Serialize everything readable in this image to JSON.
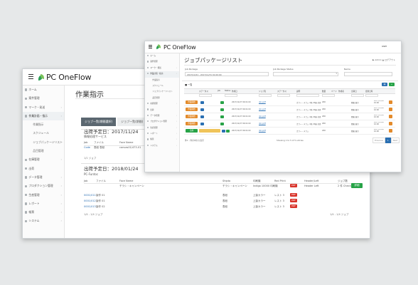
{
  "app": {
    "logo_text": "PC OneFlow"
  },
  "back_window": {
    "page_title": "作業指示",
    "sidebar": [
      {
        "label": "ホーム"
      },
      {
        "label": "案件管理"
      },
      {
        "label": "マーク・発送"
      },
      {
        "label": "作業計画・指示",
        "active": true
      },
      {
        "label": "作業指示",
        "sub": true
      },
      {
        "label": "スケジュール",
        "sub": true
      },
      {
        "label": "ジョブパッケージリスト",
        "sub": true
      },
      {
        "label": "品目管理",
        "sub": true
      },
      {
        "label": "在庫管理"
      },
      {
        "label": "出荷"
      },
      {
        "label": "データ管理"
      },
      {
        "label": "プロダクション管理"
      },
      {
        "label": "生産管理"
      },
      {
        "label": "レポート"
      },
      {
        "label": "帳票"
      },
      {
        "label": "システム"
      }
    ],
    "tabs": [
      "ジョブ一覧(期間選択)",
      "ジョブ一覧(期間)",
      "保存"
    ],
    "section1": {
      "heading": "出荷予定日：2017/11/24",
      "subheading": "情報処理サービス",
      "columns": [
        "Job",
        "ファイル",
        "Face Name"
      ],
      "rows": [
        {
          "job": "Code",
          "file": "表紙 表紙",
          "face": "canvas01/473-01"
        }
      ],
      "footer": "1/1 ジョブ"
    },
    "section2": {
      "heading": "出荷予定日：2018/01/24",
      "subheading": "PC-Funtoc",
      "columns": [
        "Job",
        "ファイル",
        "Face Name",
        "Shipto",
        "印刷機",
        "Red Print",
        "Header/Left",
        "ジョブ数"
      ],
      "header_row": {
        "face": "チラシ・キャンペーン",
        "shipto": "チラシ・キャンペーン",
        "press": "Indigo 10000 印刷機",
        "btn": "PDF",
        "header": "Header Left",
        "count": "2 件 Check",
        "action": "詳細"
      },
      "rows": [
        {
          "job": "0001/011",
          "file": "製作 01",
          "shipto": "表紙",
          "press": "上製カラー",
          "pages": "レスト 3",
          "btn": "PDF"
        },
        {
          "job": "0001/012",
          "file": "製作 01",
          "shipto": "表紙",
          "press": "上製カラー",
          "pages": "レスト 3",
          "btn": "PDF"
        },
        {
          "job": "0001/013",
          "file": "製作 02",
          "shipto": "表紙",
          "press": "上製カラー",
          "pages": "レスト 3",
          "btn": "PDF"
        }
      ],
      "footer_left": "1/4 - 1/4 ジョブ",
      "footer_right": "1/4 - 1/4 ジョブ"
    }
  },
  "front_window": {
    "page_title": "ジョブパッケージリスト",
    "user_label": "user",
    "header_right": "▶ Admin ▲ ログアウト",
    "sidebar": [
      {
        "label": "ホーム"
      },
      {
        "label": "案件管理"
      },
      {
        "label": "マーク・発送"
      },
      {
        "label": "作業計画・指示",
        "active": true
      },
      {
        "label": "作業指示",
        "sub": true
      },
      {
        "label": "スケジュール",
        "sub": true
      },
      {
        "label": "ジョブパッケージリスト",
        "sub": true
      },
      {
        "label": "品目管理",
        "sub": true
      },
      {
        "label": "在庫管理"
      },
      {
        "label": "出荷"
      },
      {
        "label": "データ管理"
      },
      {
        "label": "プロダクション管理"
      },
      {
        "label": "生産管理"
      },
      {
        "label": "レポート"
      },
      {
        "label": "帳票"
      },
      {
        "label": "システム"
      }
    ],
    "filters": {
      "label1": "Job Package",
      "value1": "2017/11/01 - 2017/11/31 01:00:00",
      "label2": "Job Package Status",
      "value2": "",
      "label3": "Name",
      "value3": ""
    },
    "list_label": "■ 一覧",
    "columns": [
      "",
      "ステータス",
      "Job",
      "Status",
      "作成日",
      "ジョブ名",
      "ステータス",
      "説明",
      "数量",
      "ページ",
      "作成者",
      "出荷日",
      "更新日時",
      ""
    ],
    "rows": [
      {
        "status": "作業開始",
        "sc": "#e38b2c",
        "created": "2017/11/27 09:01:00",
        "link": "doc.pdf",
        "desc": "カラー・チラシ 4色 20頁 全面印刷",
        "qty": "200",
        "user": "関東 東京",
        "date": "2017/11/28 10:00"
      },
      {
        "status": "作業開始",
        "sc": "#e38b2c",
        "created": "2017/11/27 09:01:00",
        "link": "doc.pdf",
        "desc": "カラー・チラシ 4色 20頁 全面印刷",
        "qty": "200",
        "user": "関東 東京",
        "date": "2017/11/28 10:00"
      },
      {
        "status": "作業開始",
        "sc": "#e38b2c",
        "created": "2017/11/27 09:01:00",
        "link": "doc.pdf",
        "desc": "カラー・チラシ 4色 20頁 全面印刷",
        "qty": "200",
        "user": "関東 東京",
        "date": "2017/11/28 10:00"
      },
      {
        "status": "作業開始",
        "sc": "#e38b2c",
        "created": "2017/11/27 09:01:00",
        "link": "doc.pdf",
        "desc": "カラー・チラシ 4色 20頁 全面印刷",
        "qty": "200",
        "user": "関東 東京",
        "date": "2017/11/28 10:00"
      },
      {
        "status": "出荷",
        "sc": "#27a347",
        "created": "2017/11/27 09:01:00",
        "link": "doc.pdf",
        "desc": "カラー・チラシ",
        "qty": "200",
        "user": "関東 東京",
        "date": "2017/11/28 10:00"
      }
    ],
    "footer_left": "件1 - 件の中から表示",
    "footer_center": "Showing 1 to 5 of 5 entries",
    "pager": [
      "Previous",
      "1",
      "Next"
    ]
  },
  "colors": {
    "accent_green": "#27a347",
    "orange": "#e38b2c",
    "red": "#d9342b",
    "blue": "#2a6fb2"
  }
}
